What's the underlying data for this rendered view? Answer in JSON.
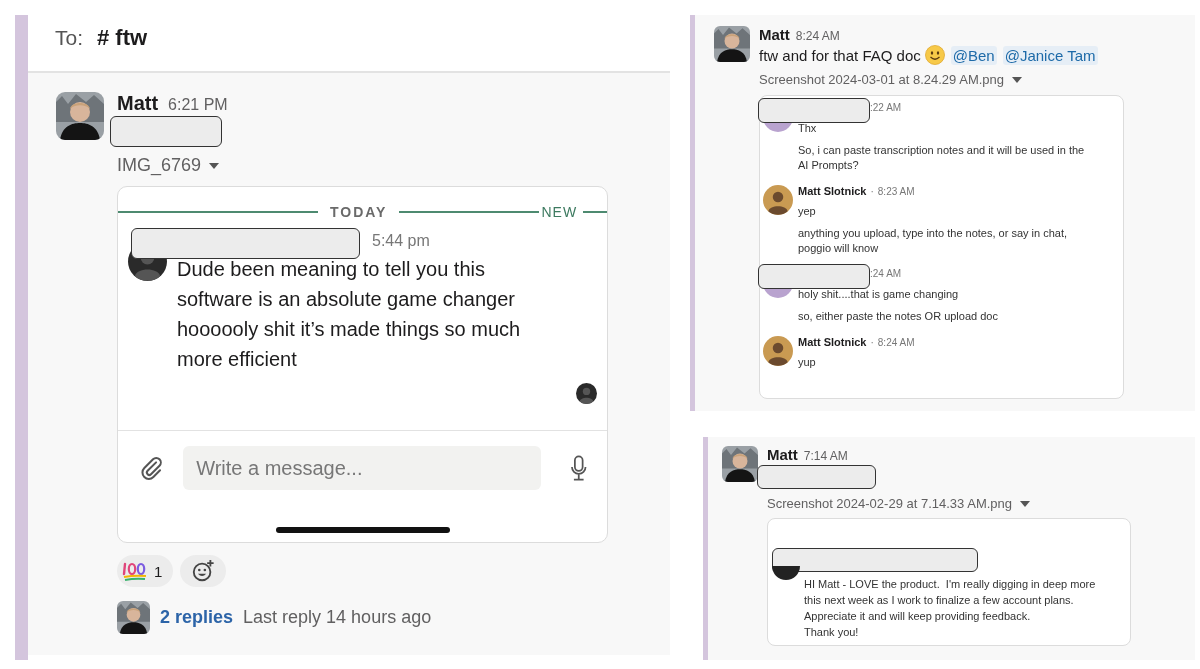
{
  "left_thread": {
    "to_label": "To:",
    "channel": "# ftw",
    "message": {
      "author": "Matt",
      "time": "6:21 PM",
      "redacted": true,
      "attachment": "IMG_6769",
      "preview": {
        "today_label": "TODAY",
        "new_label": "NEW",
        "sender_redacted": true,
        "time": "5:44 pm",
        "text": "Dude been meaning to tell you this software is an absolute game changer hoooooly shit it’s made things so much more efficient",
        "composer_placeholder": "Write a message..."
      },
      "reactions": [
        {
          "count": "1",
          "selected": false
        }
      ],
      "thread": {
        "replies": "2 replies",
        "last_reply": "Last reply 14 hours ago"
      }
    }
  },
  "faq_message": {
    "author": "Matt",
    "time": "8:24 AM",
    "text": "ftw and for that FAQ doc",
    "mentions": [
      "@Ben",
      "@Janice Tam"
    ],
    "attachment": "Screenshot 2024-03-01 at 8.24.29 AM.png",
    "preview_messages": [
      {
        "kind": "redacted",
        "time": ":22 AM",
        "lines": [
          "Thx",
          "So, i can paste transcription notes and it will be used in the AI Prompts?"
        ]
      },
      {
        "kind": "named",
        "author": "Matt Slotnick",
        "separator": "·",
        "time": "8:23 AM",
        "lines": [
          "yep",
          "anything you upload, type into the notes, or say in chat, poggio will know"
        ]
      },
      {
        "kind": "redacted",
        "time": ":24 AM",
        "lines": [
          "holy shit....that is game changing",
          "so, either paste the notes OR upload doc"
        ]
      },
      {
        "kind": "named",
        "author": "Matt Slotnick",
        "separator": "·",
        "time": "8:24 AM",
        "lines": [
          "yup"
        ]
      }
    ]
  },
  "feedback_message": {
    "author": "Matt",
    "time": "7:14 AM",
    "redacted": true,
    "attachment": "Screenshot 2024-02-29 at 7.14.33 AM.png",
    "preview": {
      "sender_redacted": true,
      "text": "HI Matt - LOVE the product.  I'm really digging in deep more this next week as I work to finalize a few account plans.  Appreciate it and will keep providing feedback.\nThank you!"
    }
  }
}
